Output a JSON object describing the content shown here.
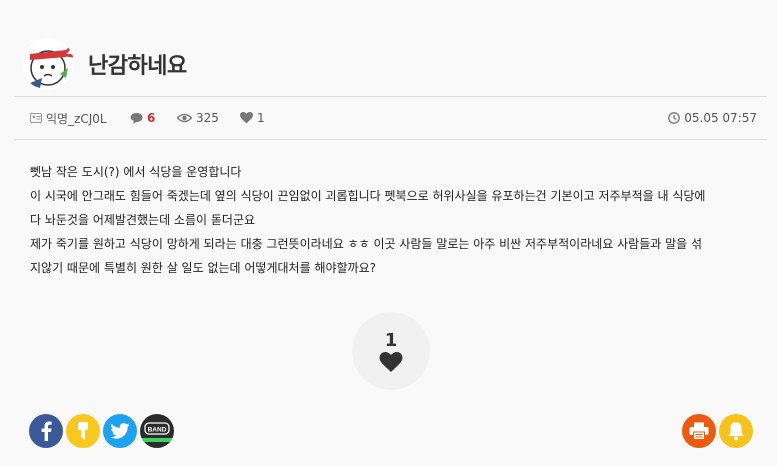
{
  "post": {
    "title": "난감하네요",
    "author": "익명_zCJ0L",
    "comments": "6",
    "views": "325",
    "likes": "1",
    "datetime": "05.05 07:57"
  },
  "content": {
    "lines": [
      "뻿남 작은 도시(?) 에서 식당을 운영합니다",
      "이 시국에 안그래도 힘들어 죽겠는데 옆의 식당이 끈임없이 괴롭힙니다 펫북으로 허위사실을 유포하는건 기본이고 저주부적을 내 식당에",
      "다 놔둔것을 어제발견했는데 소름이 돋더군요",
      "제가 죽기를 원하고 식당이 망하게 되라는 대충 그런뜻이라네요 ㅎㅎ 이곳 사람들 말로는 아주 비싼 저주부적이라네요 사람들과  말을 섞",
      "지않기 때문에 특별히 원한 살 일도 없는데 어떻게대처를 해야할까요?"
    ]
  },
  "like_box": {
    "count": "1"
  },
  "share": {
    "facebook_icon": "facebook-icon",
    "kakaostory_icon": "kakaostory-icon",
    "twitter_icon": "twitter-icon",
    "band_label": "BAND",
    "print_icon": "print-icon",
    "notify_icon": "bell-icon"
  },
  "colors": {
    "comment_count": "#d32f2f",
    "facebook": "#3b5998",
    "kakaostory": "#f9c81d",
    "twitter": "#1da1f2",
    "band": "#2c2c2c",
    "print": "#ee5a0f",
    "notify": "#f7c21a"
  }
}
